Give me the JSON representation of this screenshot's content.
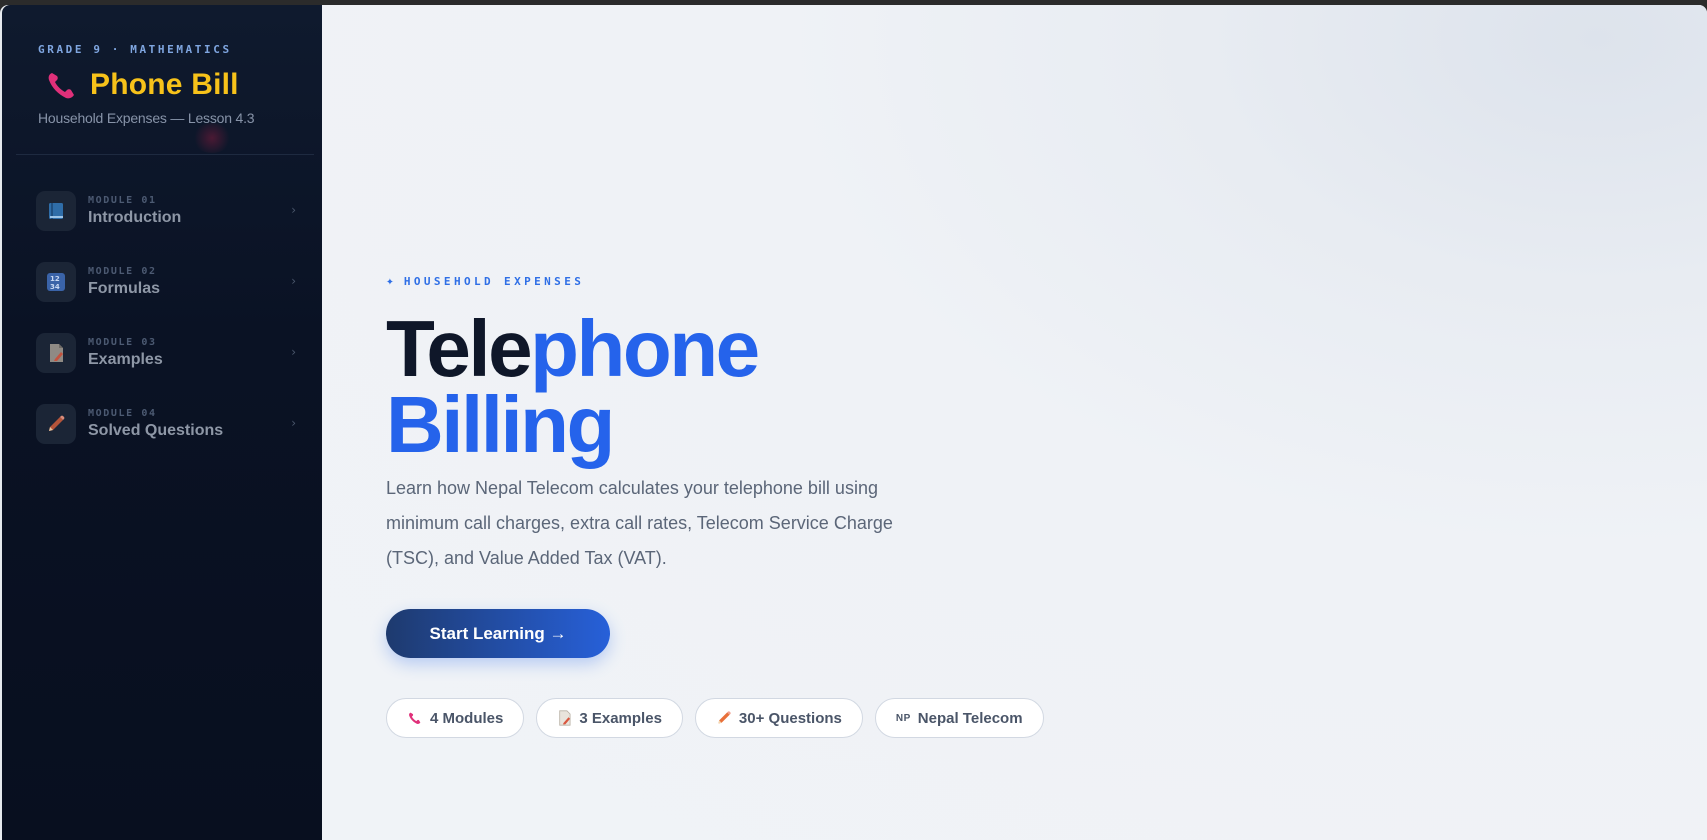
{
  "sidebar": {
    "eyebrow": "GRADE 9 · MATHEMATICS",
    "title": "Phone Bill",
    "title_icon": "telephone-icon",
    "subtitle": "Household Expenses — Lesson 4.3",
    "items": [
      {
        "module": "MODULE 01",
        "label": "Introduction",
        "icon": "book-icon"
      },
      {
        "module": "MODULE 02",
        "label": "Formulas",
        "icon": "numbers-icon"
      },
      {
        "module": "MODULE 03",
        "label": "Examples",
        "icon": "memo-icon"
      },
      {
        "module": "MODULE 04",
        "label": "Solved Questions",
        "icon": "pencil-icon"
      }
    ],
    "chevron": "›"
  },
  "hero": {
    "eyebrow": "HOUSEHOLD EXPENSES",
    "eyebrow_icon": "✦",
    "title_part1": "Tele",
    "title_part2": "phone",
    "title_line2": "Billing",
    "description": "Learn how Nepal Telecom calculates your telephone bill using minimum call charges, extra call rates, Telecom Service Charge (TSC), and Value Added Tax (VAT).",
    "cta_label": "Start Learning →"
  },
  "chips": [
    {
      "label": "4 Modules",
      "icon": "telephone-icon"
    },
    {
      "label": "3 Examples",
      "icon": "memo-icon"
    },
    {
      "label": "30+ Questions",
      "icon": "pencil-icon"
    },
    {
      "label": "Nepal Telecom",
      "icon": "nepal-flag-icon",
      "icon_text": "NP"
    }
  ],
  "colors": {
    "sidebar_bg": "#0a1224",
    "title_yellow": "#f7c21a",
    "accent_blue": "#2563eb",
    "heading_dark": "#0f1729"
  }
}
